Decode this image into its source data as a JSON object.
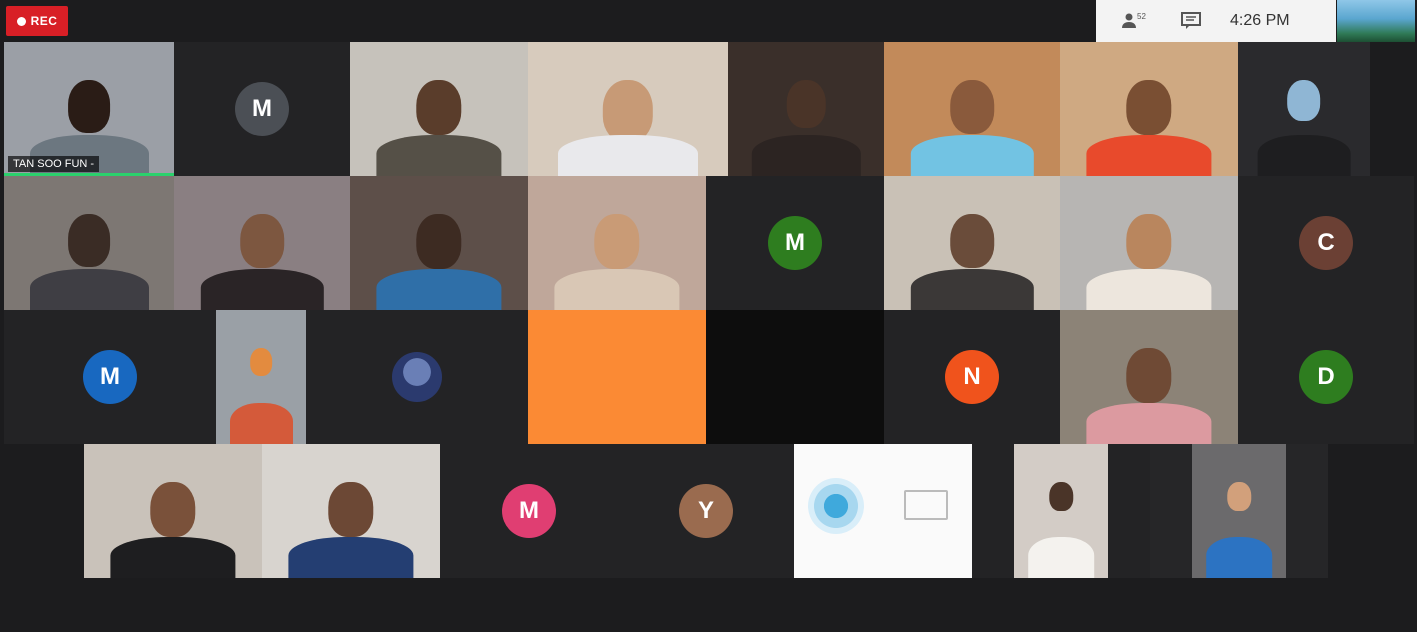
{
  "recording": {
    "label": "REC"
  },
  "top_bar": {
    "participants_icon": "participants-icon",
    "participant_count": "52",
    "chat_icon": "chat-icon",
    "time": "4:26 PM"
  },
  "colors": {
    "avatar_gray": "#4b4f55",
    "avatar_green": "#2e7d1f",
    "avatar_brown": "#6b4034",
    "avatar_blue": "#1868c0",
    "avatar_orange_red": "#f0531c",
    "avatar_pink": "#e03e72",
    "avatar_tan": "#9a6b4f",
    "tile_orange": "#fb8a34",
    "rec_red": "#d81f26"
  },
  "participants": [
    {
      "name": "TAN SOO FUN -",
      "type": "video"
    },
    {
      "initial": "M",
      "type": "avatar"
    },
    {
      "type": "video"
    },
    {
      "type": "video"
    },
    {
      "type": "video"
    },
    {
      "type": "video"
    },
    {
      "type": "video"
    },
    {
      "type": "video"
    },
    {
      "type": "video"
    },
    {
      "type": "video"
    },
    {
      "type": "video"
    },
    {
      "type": "video"
    },
    {
      "initial": "M",
      "type": "avatar"
    },
    {
      "type": "video"
    },
    {
      "type": "video"
    },
    {
      "initial": "C",
      "type": "avatar"
    },
    {
      "initial": "M",
      "type": "avatar"
    },
    {
      "type": "video"
    },
    {
      "type": "avatar-photo"
    },
    {
      "type": "blank-orange"
    },
    {
      "type": "blank-black"
    },
    {
      "initial": "N",
      "type": "avatar"
    },
    {
      "type": "video"
    },
    {
      "initial": "D",
      "type": "avatar"
    },
    {
      "type": "video"
    },
    {
      "type": "video"
    },
    {
      "initial": "M",
      "type": "avatar"
    },
    {
      "initial": "Y",
      "type": "avatar"
    },
    {
      "type": "shared-screen"
    },
    {
      "type": "video"
    },
    {
      "type": "video"
    }
  ]
}
